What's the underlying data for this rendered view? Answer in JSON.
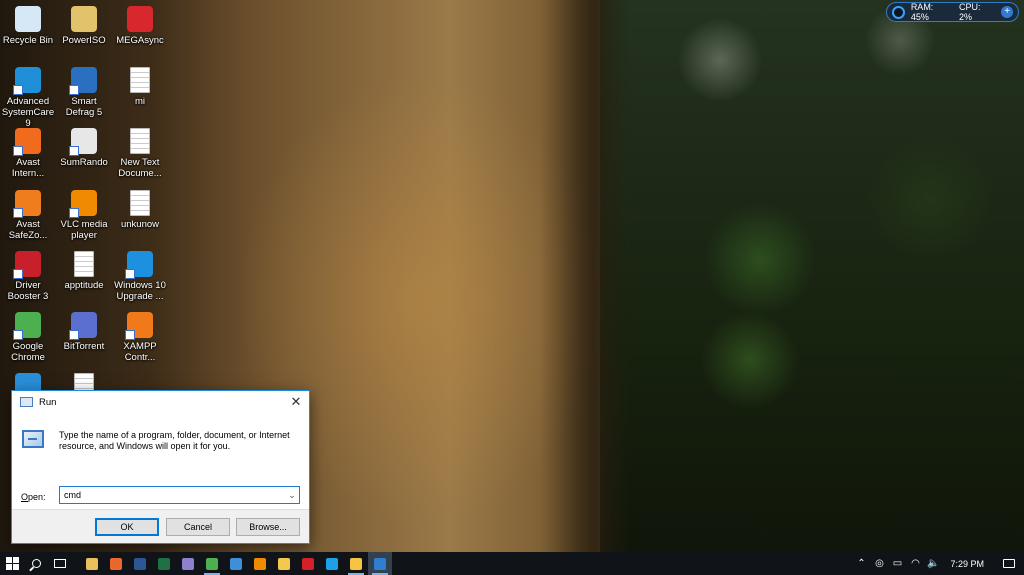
{
  "desktop_icons": [
    {
      "label": "Recycle Bin",
      "icon": "recycle-bin-icon",
      "color": "#d6e8f5",
      "type": "app"
    },
    {
      "label": "PowerISO",
      "icon": "poweriso-icon",
      "color": "#e2c26a",
      "type": "app"
    },
    {
      "label": "MEGAsync",
      "icon": "megasync-icon",
      "color": "#d9272e",
      "type": "app"
    },
    {
      "label": "Advanced SystemCare 9",
      "icon": "advanced-systemcare-icon",
      "color": "#1f8fd8",
      "type": "app"
    },
    {
      "label": "Smart Defrag 5",
      "icon": "smart-defrag-icon",
      "color": "#2a6fc0",
      "type": "app"
    },
    {
      "label": "mi",
      "icon": "text-file-icon",
      "color": "#ffffff",
      "type": "doc"
    },
    {
      "label": "Avast Intern...",
      "icon": "avast-icon",
      "color": "#f06b1d",
      "type": "app"
    },
    {
      "label": "SumRando",
      "icon": "sumrando-icon",
      "color": "#e7e7e7",
      "type": "app"
    },
    {
      "label": "New Text Docume...",
      "icon": "text-file-icon",
      "color": "#ffffff",
      "type": "doc"
    },
    {
      "label": "Avast SafeZo...",
      "icon": "avast-safezone-icon",
      "color": "#f07d1d",
      "type": "app"
    },
    {
      "label": "VLC media player",
      "icon": "vlc-icon",
      "color": "#f08a00",
      "type": "app"
    },
    {
      "label": "unkunow",
      "icon": "text-file-icon",
      "color": "#ffffff",
      "type": "doc"
    },
    {
      "label": "Driver Booster 3",
      "icon": "driver-booster-icon",
      "color": "#c8202a",
      "type": "app"
    },
    {
      "label": "apptitude",
      "icon": "text-file-icon",
      "color": "#ffffff",
      "type": "doc"
    },
    {
      "label": "Windows 10 Upgrade ...",
      "icon": "windows-10-upgrade-icon",
      "color": "#1e90e0",
      "type": "app"
    },
    {
      "label": "Google Chrome",
      "icon": "chrome-icon",
      "color": "#4caf50",
      "type": "app"
    },
    {
      "label": "BitTorrent",
      "icon": "bittorrent-icon",
      "color": "#5b6fd1",
      "type": "app"
    },
    {
      "label": "XAMPP Contr...",
      "icon": "xampp-icon",
      "color": "#f07a1a",
      "type": "app"
    },
    {
      "label": "",
      "icon": "partially-hidden-app-icon",
      "color": "#2a8fd8",
      "type": "app"
    },
    {
      "label": "",
      "icon": "text-file-icon",
      "color": "#ffffff",
      "type": "doc"
    }
  ],
  "sysmon": {
    "ram": "RAM: 45%",
    "cpu": "CPU: 2%",
    "accent": "#2e7bcf"
  },
  "run_dialog": {
    "title": "Run",
    "close_glyph": "✕",
    "description": "Type the name of a program, folder, document, or Internet resource, and Windows will open it for you.",
    "open_label_underlined": "O",
    "open_label_rest": "pen:",
    "input_value": "cmd",
    "dropdown_glyph": "⌄",
    "ok_label": "OK",
    "cancel_label": "Cancel",
    "browse_label": "Browse...",
    "accent": "#0078d7"
  },
  "taskbar": {
    "pinned": [
      {
        "icon": "file-explorer-pinned-icon",
        "color": "#e8c15c",
        "running": false
      },
      {
        "icon": "firefox-icon",
        "color": "#e8672b",
        "running": false
      },
      {
        "icon": "word-icon",
        "color": "#2b5797",
        "running": false
      },
      {
        "icon": "excel-icon",
        "color": "#1e7145",
        "running": false
      },
      {
        "icon": "cortana-app-icon",
        "color": "#8e7fd1",
        "running": false
      },
      {
        "icon": "chrome-icon",
        "color": "#4caf50",
        "running": true
      },
      {
        "icon": "network-icon",
        "color": "#3c8fd8",
        "running": false
      },
      {
        "icon": "vlc-icon",
        "color": "#f08a00",
        "running": false
      },
      {
        "icon": "python-icon",
        "color": "#f2c94c",
        "running": false
      },
      {
        "icon": "opera-icon",
        "color": "#d4202a",
        "running": false
      },
      {
        "icon": "ie-icon",
        "color": "#1ea0e8",
        "running": false
      },
      {
        "icon": "folder-icon",
        "color": "#f5c542",
        "running": true
      },
      {
        "icon": "run-icon",
        "color": "#2f7fd1",
        "running": true,
        "active": true
      }
    ],
    "tray_icons": [
      "chevron-up-icon",
      "cloud-sync-icon",
      "battery-icon",
      "wifi-icon",
      "volume-icon"
    ],
    "tray_glyphs": [
      "⌃",
      "◎",
      "▭",
      "◠",
      "🔈"
    ],
    "clock": "7:29 PM"
  }
}
